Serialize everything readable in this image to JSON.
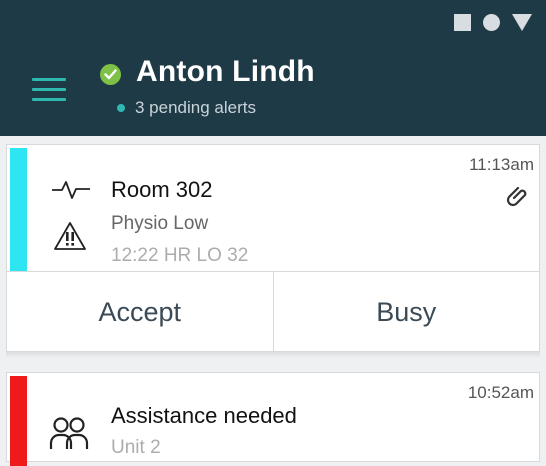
{
  "header": {
    "user_name": "Anton Lindh",
    "alerts_text": "3 pending alerts",
    "status_color": "#7ec146",
    "accent_color": "#2fb8b0",
    "background_color": "#1f3a47"
  },
  "status_bar": {
    "icons": [
      "stop-icon",
      "circle-icon",
      "triangle-icon"
    ]
  },
  "alerts": [
    {
      "time": "11:13am",
      "title": "Room 302",
      "subtitle": "Physio Low",
      "detail": "12:22 HR LO 32",
      "stripe_color": "#2de6f2",
      "icons": [
        "heartbeat-icon",
        "warning-icon",
        "attachment-icon"
      ],
      "actions": {
        "accept_label": "Accept",
        "busy_label": "Busy"
      }
    },
    {
      "time": "10:52am",
      "title": "Assistance needed",
      "subtitle": "Unit 2",
      "stripe_color": "#ef1b1b",
      "icons": [
        "people-icon"
      ]
    }
  ]
}
